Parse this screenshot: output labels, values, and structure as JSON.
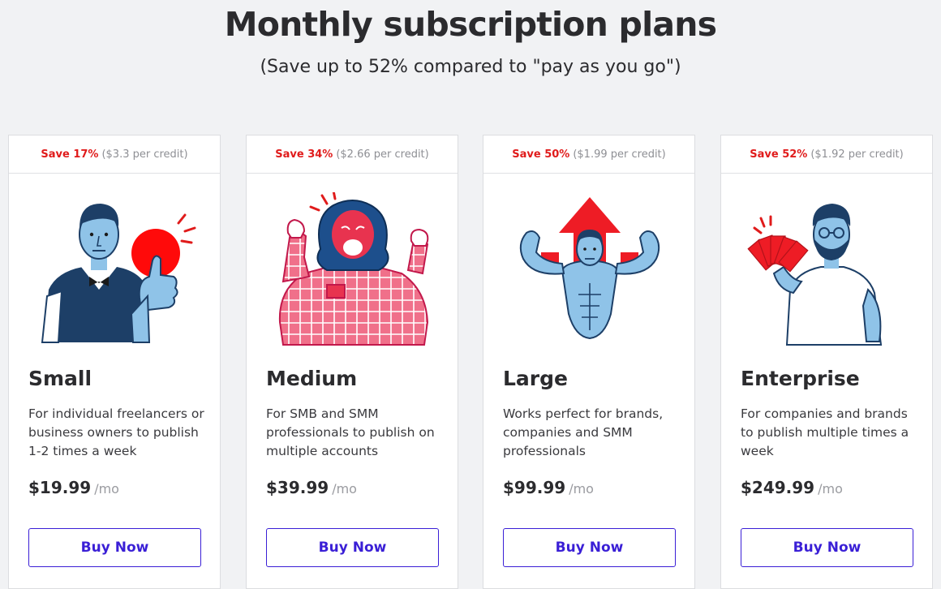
{
  "header": {
    "title": "Monthly subscription plans",
    "subtitle": "(Save up to 52% compared to \"pay as you go\")"
  },
  "colors": {
    "accent": "#3a1fd6",
    "save_red": "#e01b1b",
    "muted": "#8e8f94",
    "background": "#f1f2f4"
  },
  "plans": [
    {
      "save": "Save 17%",
      "credit": "($3.3 per credit)",
      "illustration": "thumbs-up-man-illustration",
      "name": "Small",
      "description": "For individual freelancers or business owners to publish 1-2 times a week",
      "price": "$19.99",
      "period": "/mo",
      "button": "Buy Now"
    },
    {
      "save": "Save 34%",
      "credit": "($2.66 per credit)",
      "illustration": "cheering-man-illustration",
      "name": "Medium",
      "description": "For SMB and SMM professionals to publish on multiple accounts",
      "price": "$39.99",
      "period": "/mo",
      "button": "Buy Now"
    },
    {
      "save": "Save 50%",
      "credit": "($1.99 per credit)",
      "illustration": "muscle-man-illustration",
      "name": "Large",
      "description": "Works perfect for brands, companies and SMM professionals",
      "price": "$99.99",
      "period": "/mo",
      "button": "Buy Now"
    },
    {
      "save": "Save 52%",
      "credit": "($1.92 per credit)",
      "illustration": "money-fan-man-illustration",
      "name": "Enterprise",
      "description": "For companies and brands to publish multiple times a week",
      "price": "$249.99",
      "period": "/mo",
      "button": "Buy Now"
    }
  ]
}
